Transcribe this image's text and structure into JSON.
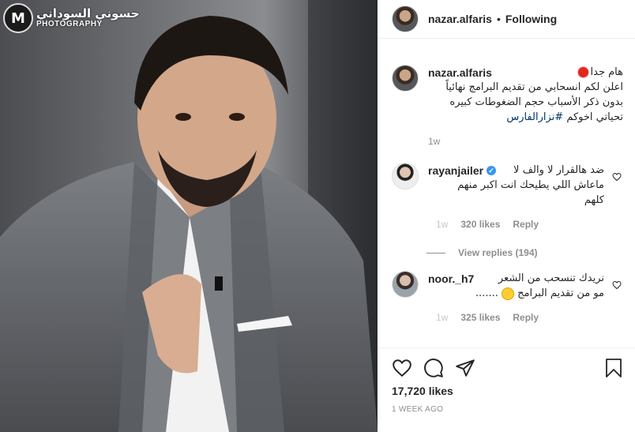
{
  "watermark": {
    "arabic": "حسوني السوداني",
    "english": "PHOTOGRAPHY",
    "logo": "M"
  },
  "header": {
    "username": "nazar.alfaris",
    "separator": "•",
    "follow_label": "Following"
  },
  "caption": {
    "username": "nazar.alfaris",
    "line1": "هام جدا",
    "line2": "اعلن لكم انسحابي من تقديم البرامج نهائياً",
    "line3": "بدون ذكر الأسباب حجم الضغوطات كبيره",
    "line4": "تحياتي اخوكم",
    "hashtag": "#نزارالفارس",
    "time": "1w"
  },
  "comments": [
    {
      "username": "rayanjailer",
      "verified": true,
      "line1": "ضد هالقرار لا والف لا",
      "line2": "ماعاش اللي يطيحك انت اكبر منهم",
      "line3": "كلهم",
      "time": "1w",
      "likes": "320 likes",
      "reply": "Reply",
      "view_replies": "View replies (194)"
    },
    {
      "username": "noor._h7",
      "line1": "نريدك تنسحب من الشعر",
      "line2": "مو من تقديم البرامج",
      "ellipsis": ".......",
      "time": "1w",
      "likes": "325 likes",
      "reply": "Reply"
    }
  ],
  "post": {
    "likes": "17,720 likes",
    "time": "1 WEEK AGO"
  },
  "icons": [
    "heart-icon",
    "comment-icon",
    "share-icon",
    "bookmark-icon"
  ]
}
